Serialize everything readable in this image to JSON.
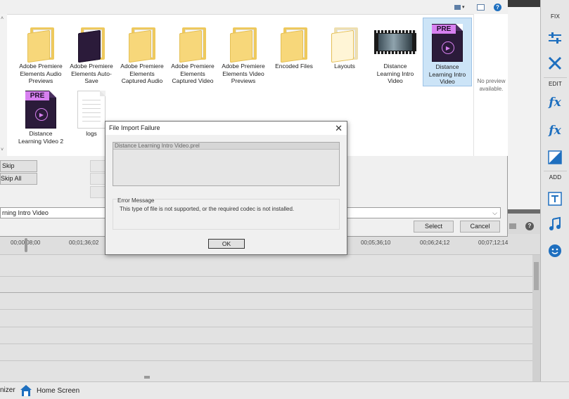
{
  "file_dialog": {
    "files": [
      {
        "name": "Adobe Premiere Elements Audio Previews",
        "kind": "folder",
        "selected": false
      },
      {
        "name": "Adobe Premiere Elements Auto-Save",
        "kind": "folder-pre",
        "selected": false
      },
      {
        "name": "Adobe Premiere Elements Captured Audio",
        "kind": "folder",
        "selected": false
      },
      {
        "name": "Adobe Premiere Elements Captured Video",
        "kind": "folder",
        "selected": false
      },
      {
        "name": "Adobe Premiere Elements Video Previews",
        "kind": "folder",
        "selected": false
      },
      {
        "name": "Encoded Files",
        "kind": "folder",
        "selected": false
      },
      {
        "name": "Layouts",
        "kind": "folder-light",
        "selected": false
      },
      {
        "name": "Distance Learning Intro Video",
        "kind": "video",
        "selected": false
      },
      {
        "name": "Distance Learning Intro Video",
        "kind": "pre",
        "selected": true
      },
      {
        "name": "Distance Learning Video 2",
        "kind": "pre",
        "selected": false
      },
      {
        "name": "logs",
        "kind": "doc",
        "selected": false
      }
    ],
    "pre_tag": "PRE",
    "preview_text": "No preview available.",
    "skip_label": "Skip",
    "skip_all_label": "Skip All",
    "filename_value": "rning Intro Video",
    "select_label": "Select",
    "cancel_label": "Cancel"
  },
  "error_dialog": {
    "title": "File Import Failure",
    "close_symbol": "✕",
    "file_header": "Distance Learning Intro Video.prel",
    "error_label": "Error Message",
    "error_text": "This type of file is not supported, or the required codec is not installed.",
    "ok_label": "OK"
  },
  "timeline": {
    "ticks": [
      "00;00;08;00",
      "00;01;36;02",
      "00;05;36;10",
      "00;06;24;12",
      "00;07;12;14"
    ]
  },
  "tool_panel": {
    "fix_label": "FIX",
    "edit_label": "EDIT",
    "add_label": "ADD"
  },
  "bottom_bar": {
    "organizer_label": "nizer",
    "home_label": "Home Screen"
  },
  "colors": {
    "accent_blue": "#1e6fbf",
    "pre_purple": "#d780f0",
    "folder_yellow": "#f7d77a"
  }
}
